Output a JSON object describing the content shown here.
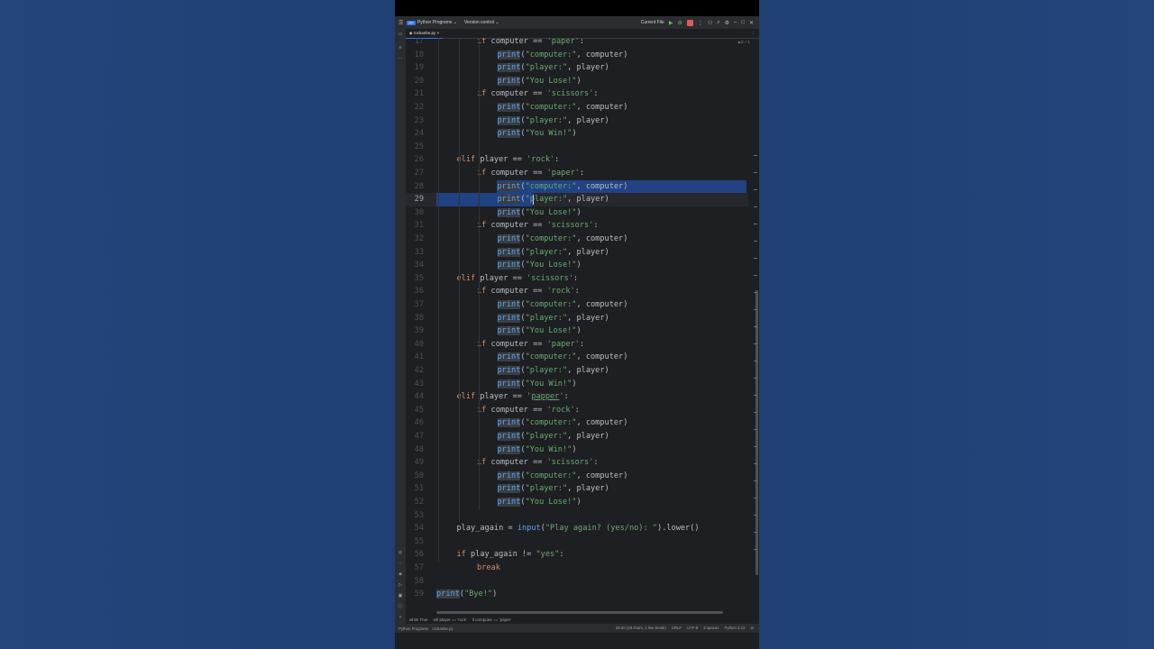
{
  "titlebar": {
    "project_badge": "PP",
    "project_name": "Python Programs",
    "vcs": "Version control",
    "run_config": "Current File"
  },
  "tab": {
    "filename": "rockanbe.py"
  },
  "hints": "▲5 ✓1",
  "code_lines": [
    {
      "n": "17",
      "indent": 2,
      "parts": [
        [
          "kw",
          "if "
        ],
        [
          "",
          "computer == "
        ],
        [
          "str",
          "'paper'"
        ],
        [
          "",
          ":"
        ]
      ]
    },
    {
      "n": "18",
      "indent": 3,
      "parts": [
        [
          "prn",
          "print"
        ],
        [
          "",
          "("
        ],
        [
          "str",
          "\"computer:\""
        ],
        [
          "",
          ", computer)"
        ]
      ]
    },
    {
      "n": "19",
      "indent": 3,
      "parts": [
        [
          "prn",
          "print"
        ],
        [
          "",
          "("
        ],
        [
          "str",
          "\"player:\""
        ],
        [
          "",
          ", player)"
        ]
      ]
    },
    {
      "n": "20",
      "indent": 3,
      "parts": [
        [
          "prn",
          "print"
        ],
        [
          "",
          "("
        ],
        [
          "str",
          "\"You Lose!\""
        ],
        [
          "",
          ")"
        ]
      ]
    },
    {
      "n": "21",
      "indent": 2,
      "parts": [
        [
          "kw",
          "if "
        ],
        [
          "",
          "computer == "
        ],
        [
          "str",
          "'scissors'"
        ],
        [
          "",
          ":"
        ]
      ]
    },
    {
      "n": "22",
      "indent": 3,
      "parts": [
        [
          "prn",
          "print"
        ],
        [
          "",
          "("
        ],
        [
          "str",
          "\"computer:\""
        ],
        [
          "",
          ", computer)"
        ]
      ]
    },
    {
      "n": "23",
      "indent": 3,
      "parts": [
        [
          "prn",
          "print"
        ],
        [
          "",
          "("
        ],
        [
          "str",
          "\"player:\""
        ],
        [
          "",
          ", player)"
        ]
      ]
    },
    {
      "n": "24",
      "indent": 3,
      "parts": [
        [
          "prn",
          "print"
        ],
        [
          "",
          "("
        ],
        [
          "str",
          "\"You Win!\""
        ],
        [
          "",
          ")"
        ]
      ]
    },
    {
      "n": "25",
      "indent": 0,
      "parts": []
    },
    {
      "n": "26",
      "indent": 1,
      "parts": [
        [
          "kw",
          "elif "
        ],
        [
          "",
          "player == "
        ],
        [
          "str",
          "'rock'"
        ],
        [
          "",
          ":"
        ]
      ]
    },
    {
      "n": "27",
      "indent": 2,
      "parts": [
        [
          "kw",
          "if "
        ],
        [
          "",
          "computer == "
        ],
        [
          "str",
          "'paper'"
        ],
        [
          "",
          ":"
        ]
      ]
    },
    {
      "n": "28",
      "indent": 3,
      "parts": [
        [
          "prn",
          "print"
        ],
        [
          "",
          "("
        ],
        [
          "str",
          "\"computer:\""
        ],
        [
          "",
          ", computer)"
        ]
      ],
      "sel": "full"
    },
    {
      "n": "29",
      "indent": 3,
      "parts": [
        [
          "prn",
          "print"
        ],
        [
          "",
          "("
        ],
        [
          "str",
          "\"player:\""
        ],
        [
          "",
          ", player)"
        ]
      ],
      "sel": "partial",
      "current": true
    },
    {
      "n": "30",
      "indent": 3,
      "parts": [
        [
          "prn",
          "print"
        ],
        [
          "",
          "("
        ],
        [
          "str",
          "\"You Lose!\""
        ],
        [
          "",
          ")"
        ]
      ]
    },
    {
      "n": "31",
      "indent": 2,
      "parts": [
        [
          "kw",
          "if "
        ],
        [
          "",
          "computer == "
        ],
        [
          "str",
          "'scissors'"
        ],
        [
          "",
          ":"
        ]
      ]
    },
    {
      "n": "32",
      "indent": 3,
      "parts": [
        [
          "prn",
          "print"
        ],
        [
          "",
          "("
        ],
        [
          "str",
          "\"computer:\""
        ],
        [
          "",
          ", computer)"
        ]
      ]
    },
    {
      "n": "33",
      "indent": 3,
      "parts": [
        [
          "prn",
          "print"
        ],
        [
          "",
          "("
        ],
        [
          "str",
          "\"player:\""
        ],
        [
          "",
          ", player)"
        ]
      ]
    },
    {
      "n": "34",
      "indent": 3,
      "parts": [
        [
          "prn",
          "print"
        ],
        [
          "",
          "("
        ],
        [
          "str",
          "\"You Lose!\""
        ],
        [
          "",
          ")"
        ]
      ]
    },
    {
      "n": "35",
      "indent": 1,
      "parts": [
        [
          "kw",
          "elif "
        ],
        [
          "",
          "player == "
        ],
        [
          "str",
          "'scissors'"
        ],
        [
          "",
          ":"
        ]
      ]
    },
    {
      "n": "36",
      "indent": 2,
      "parts": [
        [
          "kw",
          "if "
        ],
        [
          "",
          "computer == "
        ],
        [
          "str",
          "'rock'"
        ],
        [
          "",
          ":"
        ]
      ]
    },
    {
      "n": "37",
      "indent": 3,
      "parts": [
        [
          "prn",
          "print"
        ],
        [
          "",
          "("
        ],
        [
          "str",
          "\"computer:\""
        ],
        [
          "",
          ", computer)"
        ]
      ]
    },
    {
      "n": "38",
      "indent": 3,
      "parts": [
        [
          "prn",
          "print"
        ],
        [
          "",
          "("
        ],
        [
          "str",
          "\"player:\""
        ],
        [
          "",
          ", player)"
        ]
      ]
    },
    {
      "n": "39",
      "indent": 3,
      "parts": [
        [
          "prn",
          "print"
        ],
        [
          "",
          "("
        ],
        [
          "str",
          "\"You Lose!\""
        ],
        [
          "",
          ")"
        ]
      ]
    },
    {
      "n": "40",
      "indent": 2,
      "parts": [
        [
          "kw",
          "if "
        ],
        [
          "",
          "computer == "
        ],
        [
          "str",
          "'paper'"
        ],
        [
          "",
          ":"
        ]
      ]
    },
    {
      "n": "41",
      "indent": 3,
      "parts": [
        [
          "prn",
          "print"
        ],
        [
          "",
          "("
        ],
        [
          "str",
          "\"computer:\""
        ],
        [
          "",
          ", computer)"
        ]
      ]
    },
    {
      "n": "42",
      "indent": 3,
      "parts": [
        [
          "prn",
          "print"
        ],
        [
          "",
          "("
        ],
        [
          "str",
          "\"player:\""
        ],
        [
          "",
          ", player)"
        ]
      ]
    },
    {
      "n": "43",
      "indent": 3,
      "parts": [
        [
          "prn",
          "print"
        ],
        [
          "",
          "("
        ],
        [
          "str",
          "\"You Win!\""
        ],
        [
          "",
          ")"
        ]
      ]
    },
    {
      "n": "44",
      "indent": 1,
      "parts": [
        [
          "kw",
          "elif "
        ],
        [
          "",
          "player == "
        ],
        [
          "str",
          "'"
        ],
        [
          "str typo",
          "papper"
        ],
        [
          "str",
          "'"
        ],
        [
          "",
          ":"
        ]
      ]
    },
    {
      "n": "45",
      "indent": 2,
      "parts": [
        [
          "kw",
          "if "
        ],
        [
          "",
          "computer == "
        ],
        [
          "str",
          "'rock'"
        ],
        [
          "",
          ":"
        ]
      ]
    },
    {
      "n": "46",
      "indent": 3,
      "parts": [
        [
          "prn",
          "print"
        ],
        [
          "",
          "("
        ],
        [
          "str",
          "\"computer:\""
        ],
        [
          "",
          ", computer)"
        ]
      ]
    },
    {
      "n": "47",
      "indent": 3,
      "parts": [
        [
          "prn",
          "print"
        ],
        [
          "",
          "("
        ],
        [
          "str",
          "\"player:\""
        ],
        [
          "",
          ", player)"
        ]
      ]
    },
    {
      "n": "48",
      "indent": 3,
      "parts": [
        [
          "prn",
          "print"
        ],
        [
          "",
          "("
        ],
        [
          "str",
          "\"You Win!\""
        ],
        [
          "",
          ")"
        ]
      ]
    },
    {
      "n": "49",
      "indent": 2,
      "parts": [
        [
          "kw",
          "if "
        ],
        [
          "",
          "computer == "
        ],
        [
          "str",
          "'scissors'"
        ],
        [
          "",
          ":"
        ]
      ]
    },
    {
      "n": "50",
      "indent": 3,
      "parts": [
        [
          "prn",
          "print"
        ],
        [
          "",
          "("
        ],
        [
          "str",
          "\"computer:\""
        ],
        [
          "",
          ", computer)"
        ]
      ]
    },
    {
      "n": "51",
      "indent": 3,
      "parts": [
        [
          "prn",
          "print"
        ],
        [
          "",
          "("
        ],
        [
          "str",
          "\"player:\""
        ],
        [
          "",
          ", player)"
        ]
      ]
    },
    {
      "n": "52",
      "indent": 3,
      "parts": [
        [
          "prn",
          "print"
        ],
        [
          "",
          "("
        ],
        [
          "str",
          "\"You Lose!\""
        ],
        [
          "",
          ")"
        ]
      ]
    },
    {
      "n": "53",
      "indent": 0,
      "parts": []
    },
    {
      "n": "54",
      "indent": 1,
      "parts": [
        [
          "",
          "play_again = "
        ],
        [
          "fn",
          "input"
        ],
        [
          "",
          "("
        ],
        [
          "str",
          "\"Play again? (yes/no): \""
        ],
        [
          "",
          ").lower()"
        ]
      ]
    },
    {
      "n": "55",
      "indent": 0,
      "parts": []
    },
    {
      "n": "56",
      "indent": 1,
      "parts": [
        [
          "kw",
          "if "
        ],
        [
          "",
          "play_again != "
        ],
        [
          "str",
          "\"yes\""
        ],
        [
          "",
          ":"
        ]
      ]
    },
    {
      "n": "57",
      "indent": 2,
      "parts": [
        [
          "kw",
          "break"
        ]
      ]
    },
    {
      "n": "58",
      "indent": 0,
      "parts": []
    },
    {
      "n": "59",
      "indent": 0,
      "parts": [
        [
          "prn",
          "print"
        ],
        [
          "",
          "("
        ],
        [
          "str",
          "\"Bye!\""
        ],
        [
          "",
          ")"
        ]
      ]
    }
  ],
  "breadcrumbs": [
    "while True",
    "elif player == 'rock'",
    "if computer == 'paper'"
  ],
  "status": {
    "left": [
      "Python Programs",
      "rockanbe.py"
    ],
    "position": "29:20 (48 chars, 1 line break)",
    "line_sep": "CRLF",
    "encoding": "UTF-8",
    "indent": "4 spaces",
    "interpreter": "Python 3.12"
  }
}
